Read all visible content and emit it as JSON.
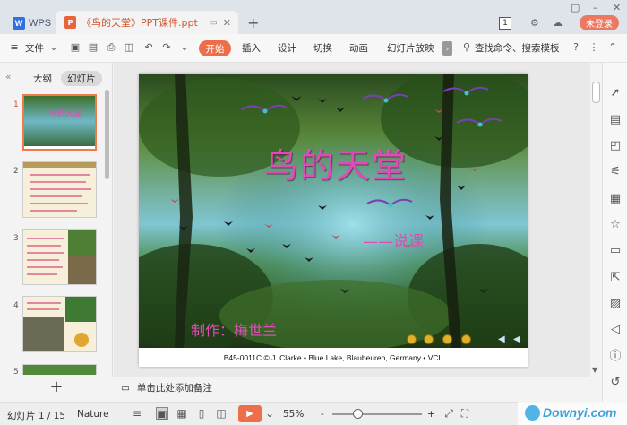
{
  "titlebar": {
    "app_name": "WPS",
    "doc_tab": "《鸟的天堂》PPT课件.ppt",
    "new_tab": "+",
    "page_count_badge": "1",
    "login_label": "未登录"
  },
  "toolbar": {
    "file_label": "文件",
    "start_label": "开始",
    "insert_label": "插入",
    "design_label": "设计",
    "switch_label": "切换",
    "animation_label": "动画",
    "slideshow_label": "幻灯片放映",
    "search_label": "查找命令、搜索模板",
    "help_icon": "?"
  },
  "left_panel": {
    "collapse": "«",
    "tab_outline": "大纲",
    "tab_slides": "幻灯片",
    "thumb_numbers": [
      "1",
      "2",
      "3",
      "4",
      "5"
    ],
    "add_label": "+"
  },
  "slide": {
    "title": "鸟的天堂",
    "subtitle": "——说课",
    "author": "制作：梅世兰",
    "caption": "B45-0011C  © J. Clarke • Blue Lake, Blaubeuren, Germany • VCL"
  },
  "notes": {
    "placeholder": "单击此处添加备注"
  },
  "statusbar": {
    "slide_info": "幻灯片 1 / 15",
    "theme": "Nature",
    "zoom": "55%",
    "zoom_minus": "-",
    "zoom_plus": "+",
    "zoom_level": 0.28
  },
  "watermark": {
    "text": "Downyi.com"
  },
  "colors": {
    "accent": "#ec6f4a",
    "title_pink": "#e04bb8",
    "doc_tab_text": "#d2542e"
  }
}
